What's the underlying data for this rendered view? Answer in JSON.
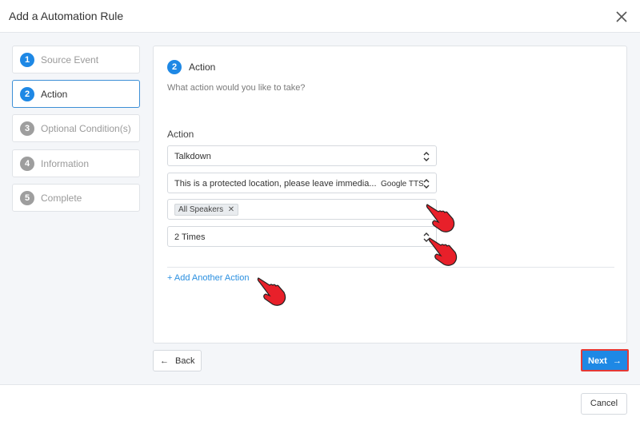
{
  "dialog": {
    "title": "Add a Automation Rule"
  },
  "steps": [
    {
      "number": "1",
      "label": "Source Event",
      "state": "done"
    },
    {
      "number": "2",
      "label": "Action",
      "state": "active"
    },
    {
      "number": "3",
      "label": "Optional Condition(s)",
      "state": "pending"
    },
    {
      "number": "4",
      "label": "Information",
      "state": "pending"
    },
    {
      "number": "5",
      "label": "Complete",
      "state": "pending"
    }
  ],
  "panel": {
    "step_number": "2",
    "title": "Action",
    "subtitle": "What action would you like to take?",
    "field_label": "Action",
    "action_type": "Talkdown",
    "message": "This is a protected location, please leave immedia...",
    "voice": "Google TTS",
    "speakers_tag": "All Speakers",
    "repeat": "2 Times",
    "add_action_label": "+ Add Another Action"
  },
  "nav": {
    "back_label": "Back",
    "next_label": "Next"
  },
  "footer": {
    "cancel_label": "Cancel"
  },
  "colors": {
    "accent": "#1e88e5",
    "highlight": "#e53935",
    "pointer": "#e8202a"
  },
  "icons": [
    "close-icon",
    "chevron-updown-icon",
    "tag-remove-icon",
    "arrow-left-icon",
    "arrow-right-icon",
    "pointing-hand-icon"
  ]
}
